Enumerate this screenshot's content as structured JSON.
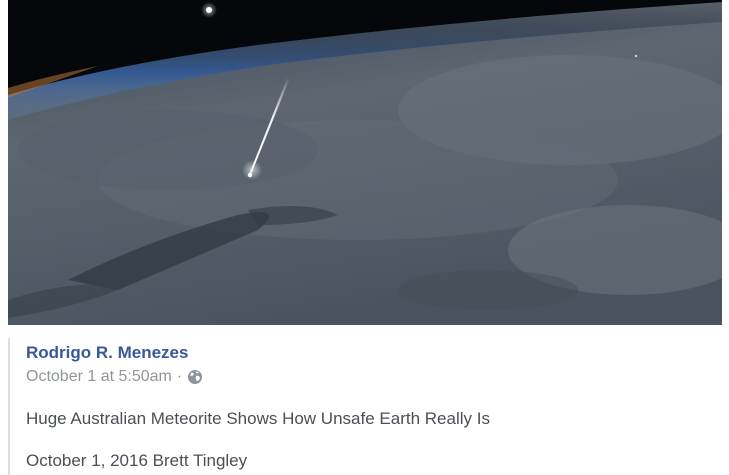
{
  "image": {
    "icon": "meteor-photo",
    "colors": {
      "space": "#07080c",
      "atmosphere": "#2b4a7a",
      "earth": "#5a6470",
      "meteor": "#ffffff"
    }
  },
  "post": {
    "author": "Rodrigo R. Menezes",
    "timestamp": "October 1 at 5:50am",
    "separator": "·",
    "privacy_icon": "globe-icon",
    "headline": "Huge Australian Meteorite Shows How Unsafe Earth Really Is",
    "byline": "October 1, 2016 Brett Tingley"
  },
  "colors": {
    "author_link": "#385898",
    "meta_text": "#90949c",
    "body_text": "#4b4f56",
    "quote_border": "#dddfe2"
  }
}
